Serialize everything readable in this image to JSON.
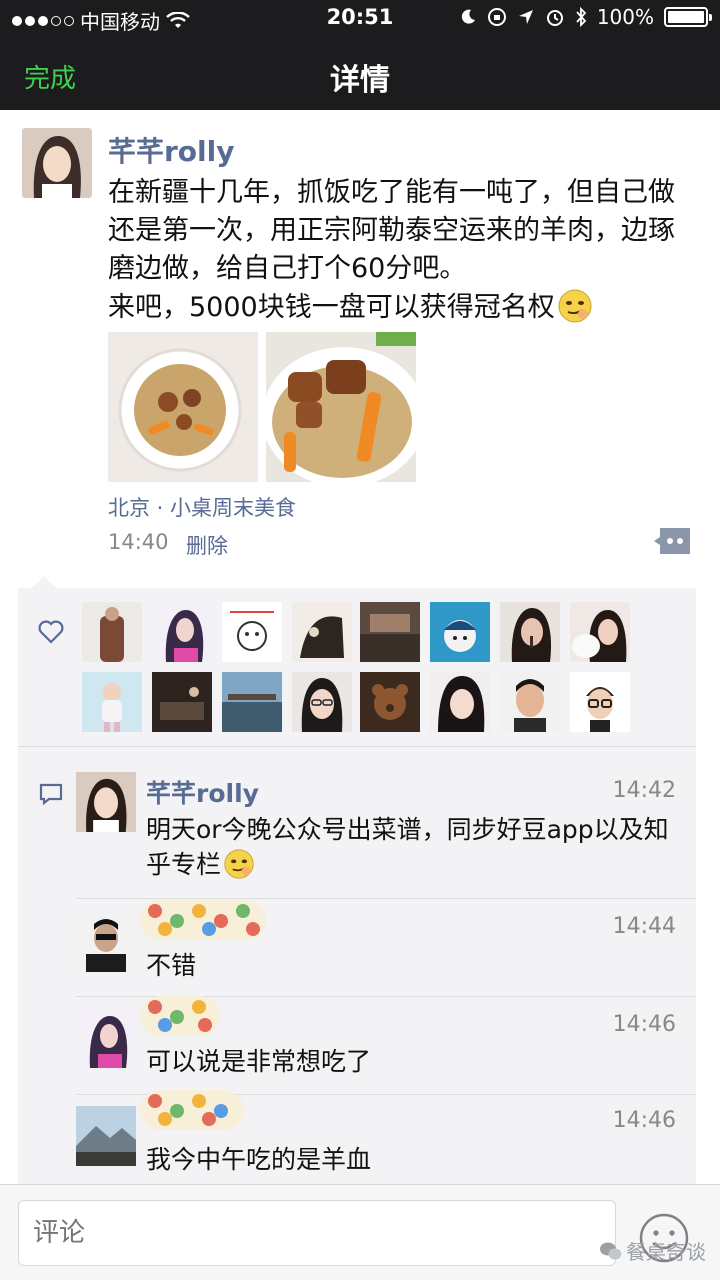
{
  "status_bar": {
    "carrier": "中国移动",
    "time": "20:51",
    "battery": "100%"
  },
  "nav": {
    "done_label": "完成",
    "title": "详情"
  },
  "post": {
    "author": "芊芊rolly",
    "text": "在新疆十几年，抓饭吃了能有一吨了，但自己做还是第一次，用正宗阿勒泰空运来的羊肉，边琢磨边做，给自己打个60分吧。\n来吧，5000块钱一盘可以获得冠名权",
    "location": "北京 · 小桌周末美食",
    "time": "14:40",
    "delete_label": "删除"
  },
  "comments": [
    {
      "name": "芊芊rolly",
      "time": "14:42",
      "text": "明天or今晚公众号出菜谱，同步好豆app以及知乎专栏"
    },
    {
      "name": "",
      "time": "14:44",
      "text": "不错"
    },
    {
      "name": "",
      "time": "14:46",
      "text": "可以说是非常想吃了"
    },
    {
      "name": "",
      "time": "14:46",
      "text": "我今中午吃的是羊血"
    }
  ],
  "input": {
    "placeholder": "评论"
  },
  "watermark": "餐桌奇谈",
  "colors": {
    "nav_bg": "#1c1c1e",
    "done_green": "#3fd04f",
    "link_blue": "#576b95",
    "panel_bg": "#f3f3f5"
  }
}
